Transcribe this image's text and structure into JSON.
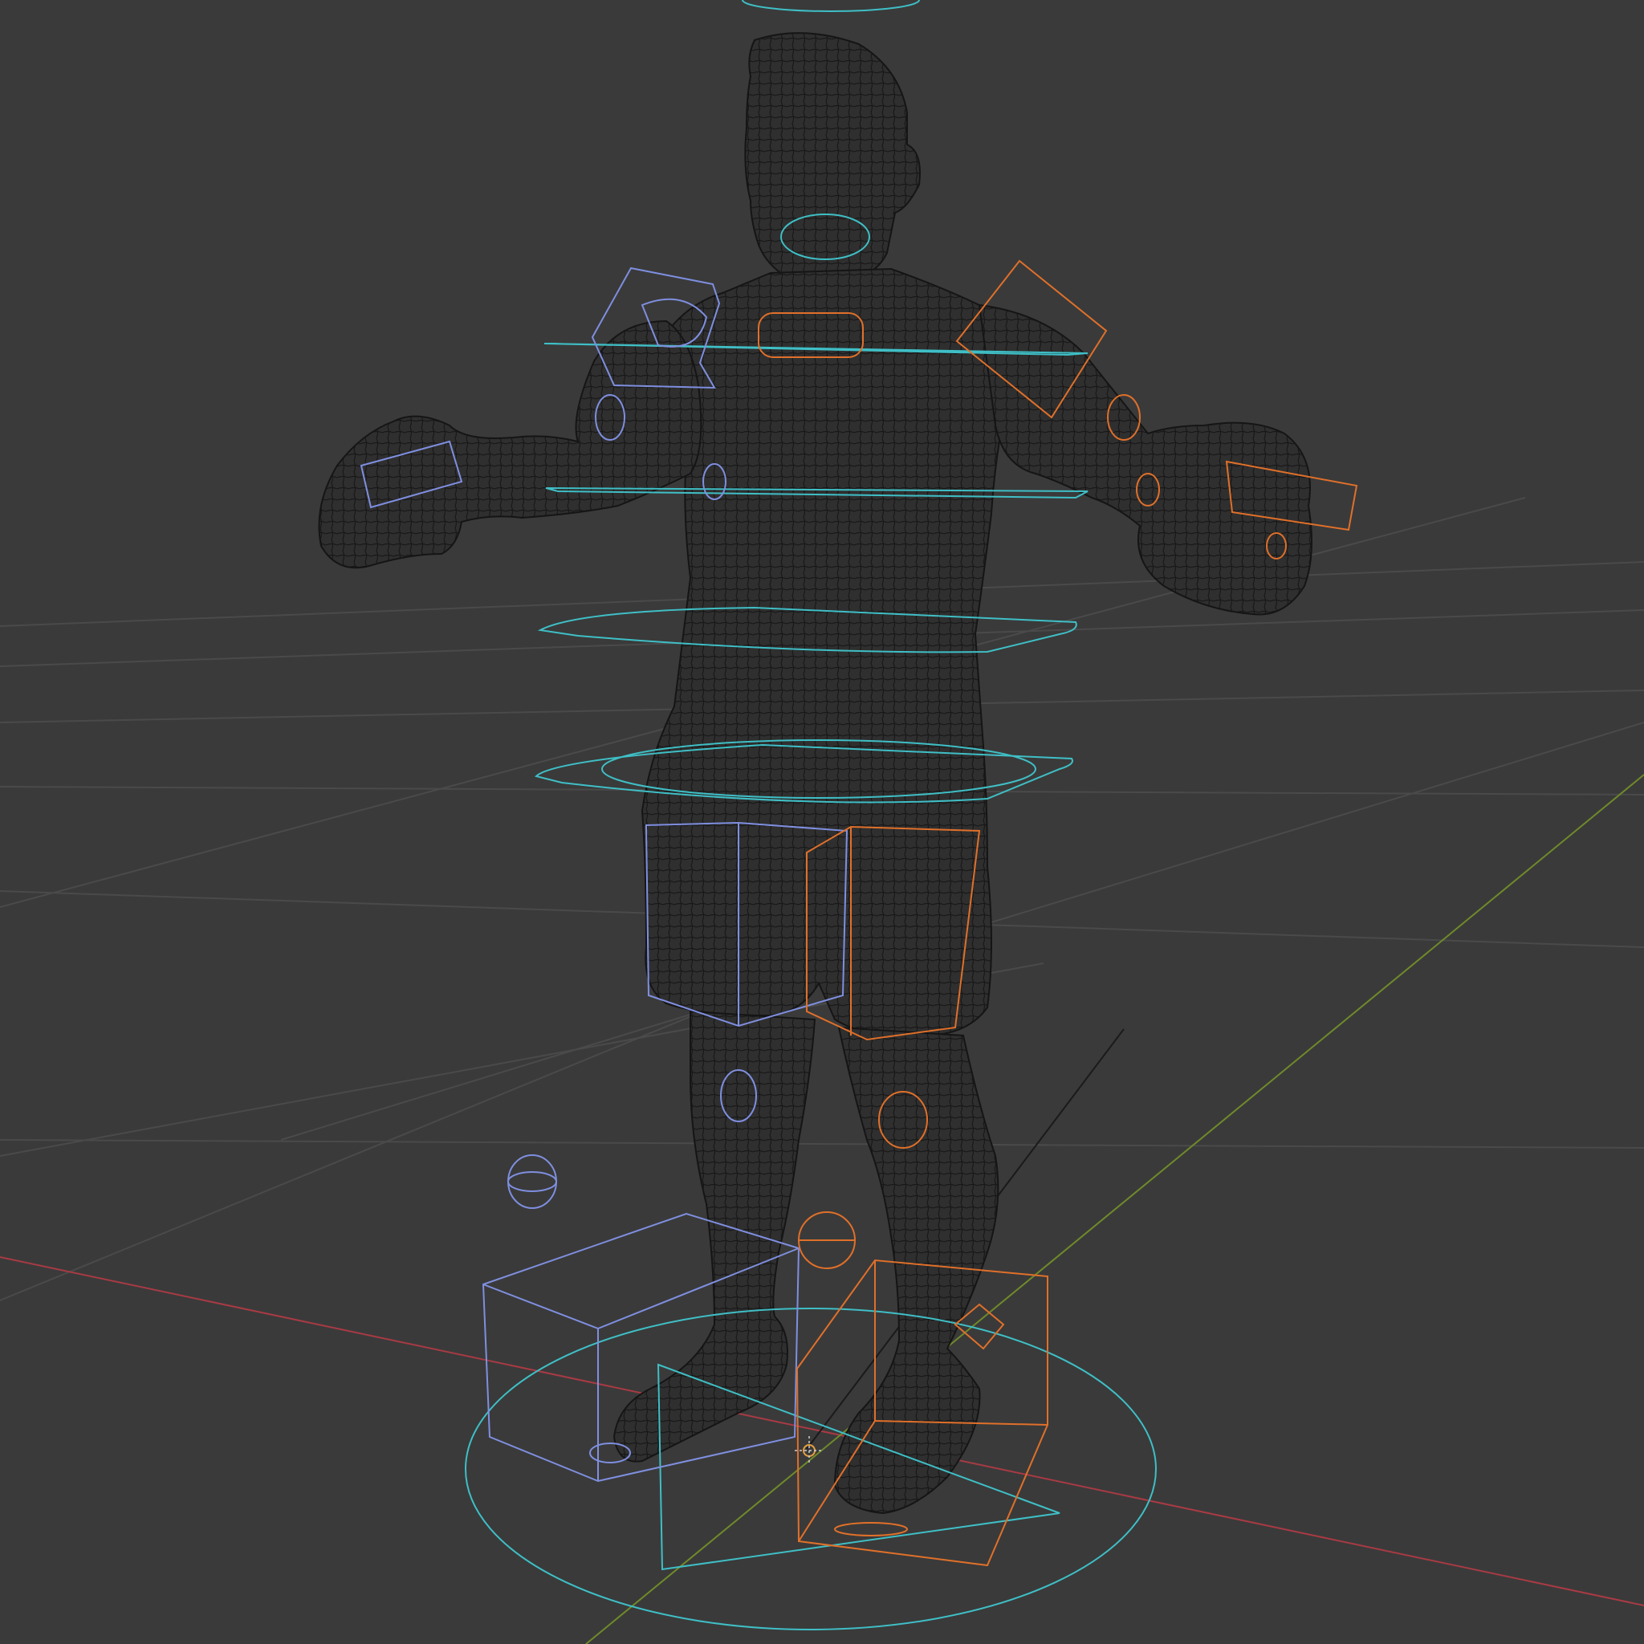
{
  "viewport": {
    "view_mode": "wireframe",
    "colors": {
      "background": "#3a3a3a",
      "grid": "#4a4a4a",
      "x_axis": "#a83a44",
      "y_axis": "#6f8a2a",
      "mesh": "#161616",
      "ik_control_left": "#7f8fe0",
      "ik_control_right": "#e0702a",
      "control_center": "#3fbfc6"
    },
    "icons": [
      "3d-cursor-icon"
    ]
  }
}
